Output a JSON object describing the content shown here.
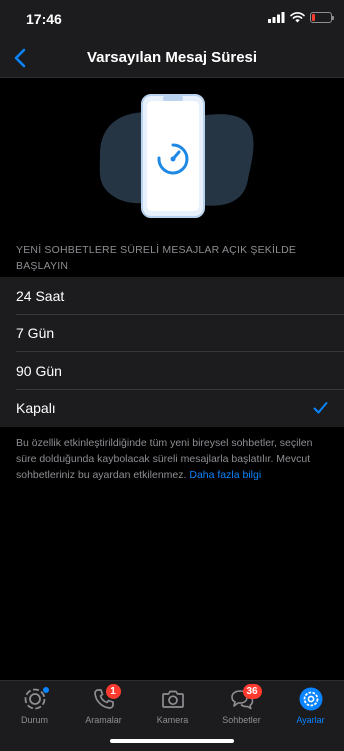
{
  "status_bar": {
    "time": "17:46",
    "battery_level": 0.15
  },
  "header": {
    "title": "Varsayılan Mesaj Süresi",
    "back_icon": "chevron-left-icon"
  },
  "hero": {
    "icon": "phone-timer-illustration"
  },
  "section_header": "YENİ SOHBETLERE SÜRELİ MESAJLAR AÇIK ŞEKİLDE BAŞLAYIN",
  "options": [
    {
      "label": "24 Saat",
      "selected": false
    },
    {
      "label": "7 Gün",
      "selected": false
    },
    {
      "label": "90 Gün",
      "selected": false
    },
    {
      "label": "Kapalı",
      "selected": true
    }
  ],
  "footer": {
    "text": "Bu özellik etkinleştirildiğinde tüm yeni bireysel sohbetler, seçilen süre dolduğunda kaybolacak süreli mesajlarla başlatılır. Mevcut sohbetleriniz bu ayardan etkilenmez. ",
    "link": "Daha fazla bilgi"
  },
  "tabs": [
    {
      "label": "Durum",
      "icon": "status-icon",
      "badge": "",
      "active": false
    },
    {
      "label": "Aramalar",
      "icon": "phone-icon",
      "badge": "1",
      "active": false
    },
    {
      "label": "Kamera",
      "icon": "camera-icon",
      "badge": "",
      "active": false
    },
    {
      "label": "Sohbetler",
      "icon": "chat-bubbles-icon",
      "badge": "36",
      "active": false
    },
    {
      "label": "Ayarlar",
      "icon": "gear-icon",
      "badge": "",
      "active": true
    }
  ],
  "colors": {
    "accent": "#0a84ff",
    "badge": "#ff3b30",
    "background": "#000000",
    "surface": "#1c1c1e"
  }
}
